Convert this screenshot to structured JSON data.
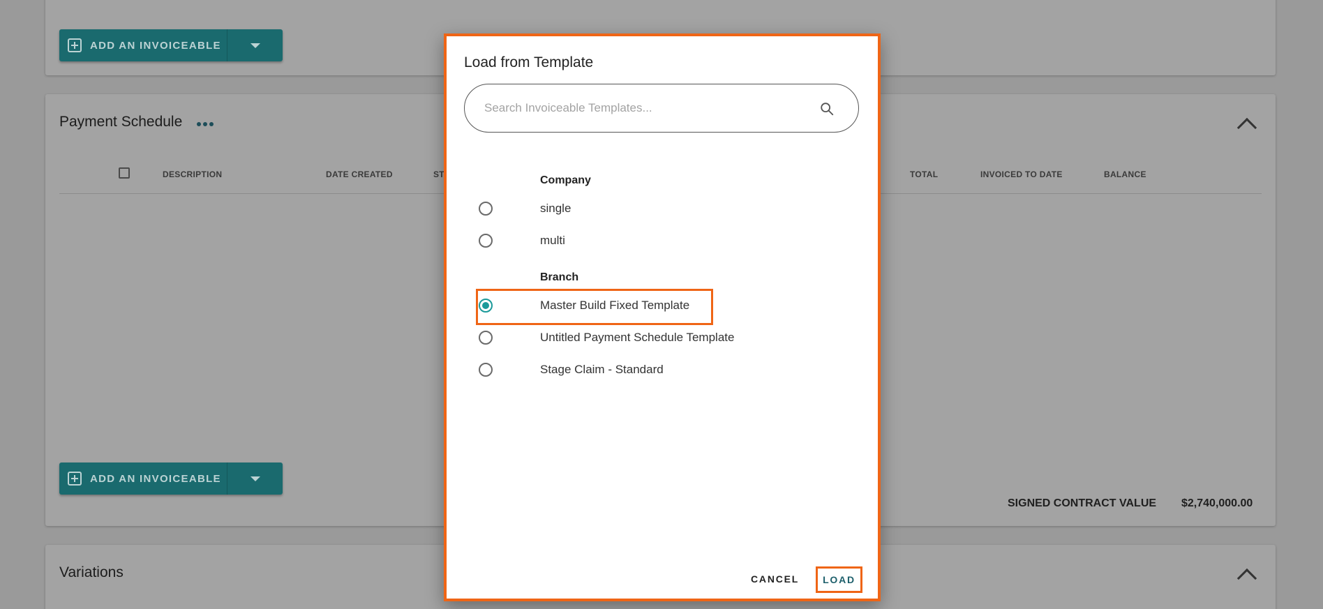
{
  "background": {
    "add_invoiceable_label": "ADD AN INVOICEABLE",
    "payment_schedule": {
      "title": "Payment Schedule",
      "columns": [
        "DESCRIPTION",
        "DATE CREATED",
        "ST",
        "TOTAL",
        "INVOICED TO DATE",
        "BALANCE"
      ],
      "signed_contract_label": "SIGNED CONTRACT VALUE",
      "signed_contract_value": "$2,740,000.00"
    },
    "variations": {
      "title": "Variations"
    }
  },
  "modal": {
    "title": "Load from Template",
    "search": {
      "placeholder": "Search Invoiceable Templates...",
      "value": ""
    },
    "groups": [
      {
        "label": "Company",
        "options": [
          {
            "label": "single",
            "selected": false
          },
          {
            "label": "multi",
            "selected": false
          }
        ]
      },
      {
        "label": "Branch",
        "options": [
          {
            "label": "Master Build Fixed Template",
            "selected": true
          },
          {
            "label": "Untitled Payment Schedule Template",
            "selected": false
          },
          {
            "label": "Stage Claim - Standard",
            "selected": false
          }
        ]
      }
    ],
    "cancel_label": "CANCEL",
    "load_label": "LOAD"
  },
  "colors": {
    "highlight": "#ef6516",
    "accent": "#1b9a9a",
    "primary_button": "#1a6a6e"
  },
  "icons": [
    "add-box-icon",
    "dropdown-caret-icon",
    "more-horizontal-icon",
    "chevron-up-icon",
    "search-icon",
    "radio-icon"
  ]
}
